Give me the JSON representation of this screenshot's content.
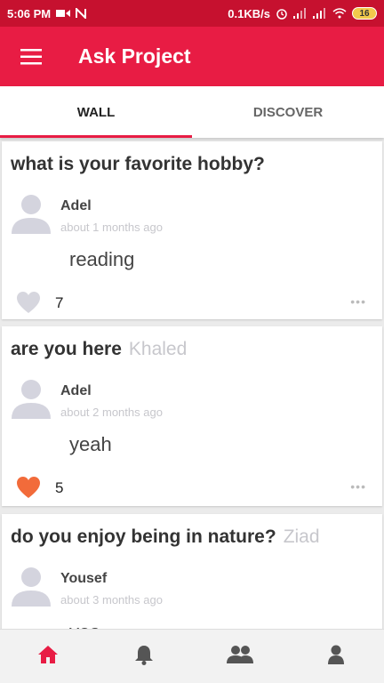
{
  "status_bar": {
    "time": "5:06 PM",
    "network_speed": "0.1KB/s",
    "battery": "16",
    "icons": [
      "video-icon",
      "n-icon",
      "alarm-icon",
      "signal-icon",
      "signal-icon",
      "wifi-icon",
      "battery-icon"
    ]
  },
  "app_bar": {
    "title": "Ask Project",
    "menu_icon": "hamburger-menu-icon"
  },
  "colors": {
    "accent": "#e81c44",
    "status_bar": "#c6112f",
    "like_active": "#f26b3a",
    "like_inactive": "#d6d6de"
  },
  "tabs": [
    {
      "label": "WALL",
      "active": true
    },
    {
      "label": "DISCOVER",
      "active": false
    }
  ],
  "posts": [
    {
      "question": "what is your favorite hobby?",
      "asked_to": "",
      "user": "Adel",
      "time": "about 1 months ago",
      "answer": "reading",
      "likes": "7",
      "liked": false,
      "more": "•••"
    },
    {
      "question": "are you here",
      "asked_to": "Khaled",
      "user": "Adel",
      "time": "about 2 months ago",
      "answer": "yeah",
      "likes": "5",
      "liked": true,
      "more": "•••"
    },
    {
      "question": "do you enjoy being in nature?",
      "asked_to": "Ziad",
      "user": "Yousef",
      "time": "about 3 months ago",
      "answer": "yes",
      "likes": "",
      "liked": false,
      "more": ""
    }
  ],
  "bottom_nav": [
    {
      "name": "home",
      "icon": "home-icon",
      "active": true
    },
    {
      "name": "notifications",
      "icon": "bell-icon",
      "active": false
    },
    {
      "name": "people",
      "icon": "people-icon",
      "active": false
    },
    {
      "name": "profile",
      "icon": "person-icon",
      "active": false
    }
  ]
}
